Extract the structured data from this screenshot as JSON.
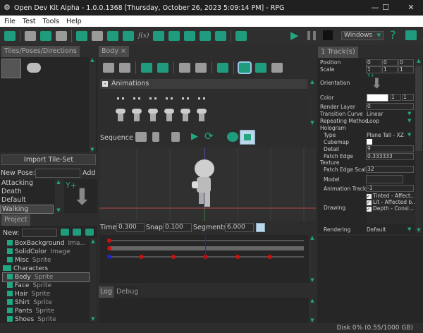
{
  "window": {
    "title": "Open Dev Kit Alpha - 1.0.0.1368 [Thursday, October 26, 2023 5:09:14 PM] - RPG",
    "minimize": "—",
    "maximize": "☐",
    "close": "✕"
  },
  "menu": [
    "File",
    "Test",
    "Tools",
    "Help"
  ],
  "toolbar": {
    "platform": "Windows",
    "help": "?"
  },
  "left": {
    "tab": "Tiles/Poses/Directions",
    "import_button": "Import Tile-Set",
    "new_pose_label": "New Pose:",
    "new_pose_value": "",
    "add_button": "Add",
    "poses": [
      "Attacking",
      "Death",
      "Default",
      "Walking"
    ],
    "selected_pose": "Walking",
    "orientation_label": "Y+"
  },
  "project": {
    "tab": "Project",
    "new_label": "New:",
    "new_value": "",
    "items": [
      {
        "name": "BoxBackground",
        "kind": "Ima...",
        "icon": "image",
        "indent": 1
      },
      {
        "name": "SolidColor",
        "kind": "Image",
        "icon": "image",
        "indent": 1
      },
      {
        "name": "Misc",
        "kind": "Sprite",
        "icon": "sprite",
        "indent": 1
      },
      {
        "name": "Characters",
        "kind": "",
        "icon": "folder",
        "indent": 0
      },
      {
        "name": "Body",
        "kind": "Sprite",
        "icon": "sprite",
        "indent": 1,
        "selected": true
      },
      {
        "name": "Face",
        "kind": "Sprite",
        "icon": "sprite",
        "indent": 1
      },
      {
        "name": "Hair",
        "kind": "Sprite",
        "icon": "sprite",
        "indent": 1
      },
      {
        "name": "Shirt",
        "kind": "Sprite",
        "icon": "sprite",
        "indent": 1
      },
      {
        "name": "Pants",
        "kind": "Sprite",
        "icon": "sprite",
        "indent": 1
      },
      {
        "name": "Shoes",
        "kind": "Sprite",
        "icon": "sprite",
        "indent": 1
      }
    ]
  },
  "center": {
    "tab": "Body ×",
    "animations_header": "Animations",
    "sequence_label": "Sequence",
    "time_label": "Time",
    "time": "0.300",
    "snap_label": "Snap",
    "snap": "0.100",
    "segments_label": "Segments",
    "segments": "6.000",
    "timeline_playhead": 0.5,
    "keyframes": [
      0,
      0.1667,
      0.3333,
      0.5,
      0.6667,
      0.8333
    ]
  },
  "bottom": {
    "tabs": [
      "Log",
      "Debug"
    ]
  },
  "right": {
    "tab": "1 Track(s)",
    "position_label": "Position",
    "position": [
      "0",
      "0",
      "0"
    ],
    "scale_label": "Scale",
    "scale": [
      "1",
      "1",
      "1"
    ],
    "orientation_label": "Orientation",
    "orientation_axis": "Y+",
    "color_label": "Color",
    "color": "#ffffff",
    "color_vals": [
      "1",
      "1"
    ],
    "render_layer_label": "Render Layer",
    "render_layer": "0",
    "transition_label": "Transition Curve",
    "transition": "Linear",
    "repeat_label": "Repeating Method",
    "repeat": "Loop",
    "hologram_label": "Hologram",
    "type_label": "Type",
    "type": "Plane Tall - XZ",
    "cubemap_label": "Cubemap",
    "detail_label": "Detail",
    "detail": "9",
    "patch_edge_label": "Patch Edge",
    "patch_edge": "0.333333",
    "texture_label": "Texture",
    "patch_scale_label": "Patch Edge Scale",
    "patch_scale": "32",
    "model_label": "Model",
    "anim_track_label": "Animation Track",
    "anim_track": "-1",
    "drawing_label": "Drawing",
    "drawing": [
      "Tinted - Affect...",
      "Lit - Affected b...",
      "Depth - Consi..."
    ],
    "rendering_label": "Rendering",
    "rendering": "Default"
  },
  "status": {
    "disk": "Disk 0% (0.55/1000 GB)"
  },
  "colors": {
    "accent": "#1fa882",
    "keyframe": "#cc1111",
    "playhead": "#2222cc"
  }
}
